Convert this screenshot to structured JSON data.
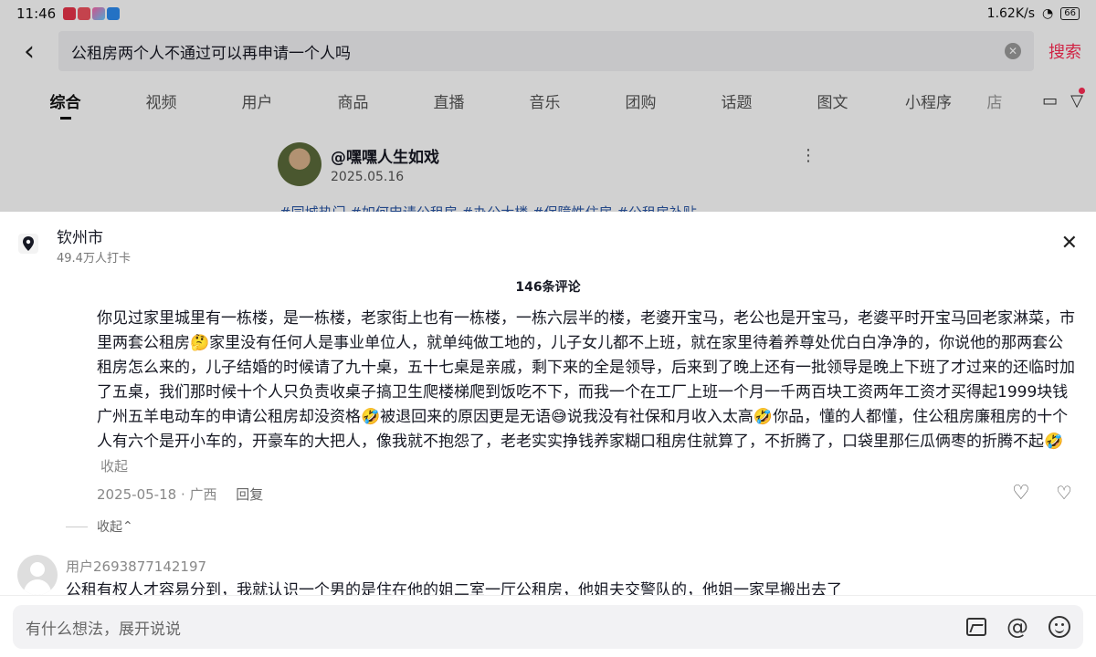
{
  "status_bar": {
    "time": "11:46",
    "net_speed": "1.62K/s",
    "battery": "66"
  },
  "search": {
    "query": "公租房两个人不通过可以再申请一个人吗",
    "button": "搜索"
  },
  "tabs": [
    "综合",
    "视频",
    "用户",
    "商品",
    "直播",
    "音乐",
    "团购",
    "话题",
    "图文",
    "小程序",
    "店"
  ],
  "card": {
    "author": "@嘿嘿人生如戏",
    "date": "2025.05.16",
    "tags": "#同城热门 #如何申请公租房 #办公大楼 #保障性住房 #公租房补贴"
  },
  "location": {
    "name": "钦州市",
    "checkins": "49.4万人打卡"
  },
  "comments_count": "146条评论",
  "reply": {
    "p1": "你见过家里城里有一栋楼，是一栋楼，老家街上也有一栋楼，一栋六层半的楼，老婆开宝马，老公也是开宝马，老婆平时开宝马回老家淋菜，市里两套公租房",
    "e1": "🤔",
    "p2": "家里没有任何人是事业单位人，就单纯做工地的，儿子女儿都不上班，就在家里待着养尊处优白白净净的，你说他的那两套公租房怎么来的，儿子结婚的时候请了九十桌，五十七桌是亲戚，剩下来的全是领导，后来到了晚上还有一批领导是晚上下班了才过来的还临时加了五桌，我们那时候十个人只负责收桌子搞卫生爬楼梯爬到饭吃不下，而我一个在工厂上班一个月一千两百块工资两年工资才买得起1999块钱广州五羊电动车的申请公租房却没资格",
    "e2": "🤣",
    "p3": "被退回来的原因更是无语",
    "e3": "😅",
    "p4": "说我没有社保和月收入太高",
    "e4": "🤣",
    "p5": "你品，懂的人都懂，住公租房廉租房的十个人有六个是开小车的，开豪车的大把人，像我就不抱怨了，老老实实挣钱养家糊口租房住就算了，不折腾了，口袋里那仨瓜俩枣的折腾不起",
    "e5": "🤣",
    "collapse": "收起",
    "date": "2025-05-18",
    "region": "广西",
    "reply_label": "回复"
  },
  "fold_label": "收起",
  "comment2": {
    "user": "用户2693877142197",
    "text": "公租有权人才容易分到，我就认识一个男的是住在他的姐二室一厅公租房，他姐夫交警队的，他姐一家早搬出去了"
  },
  "input": {
    "placeholder": "有什么想法，展开说说"
  }
}
